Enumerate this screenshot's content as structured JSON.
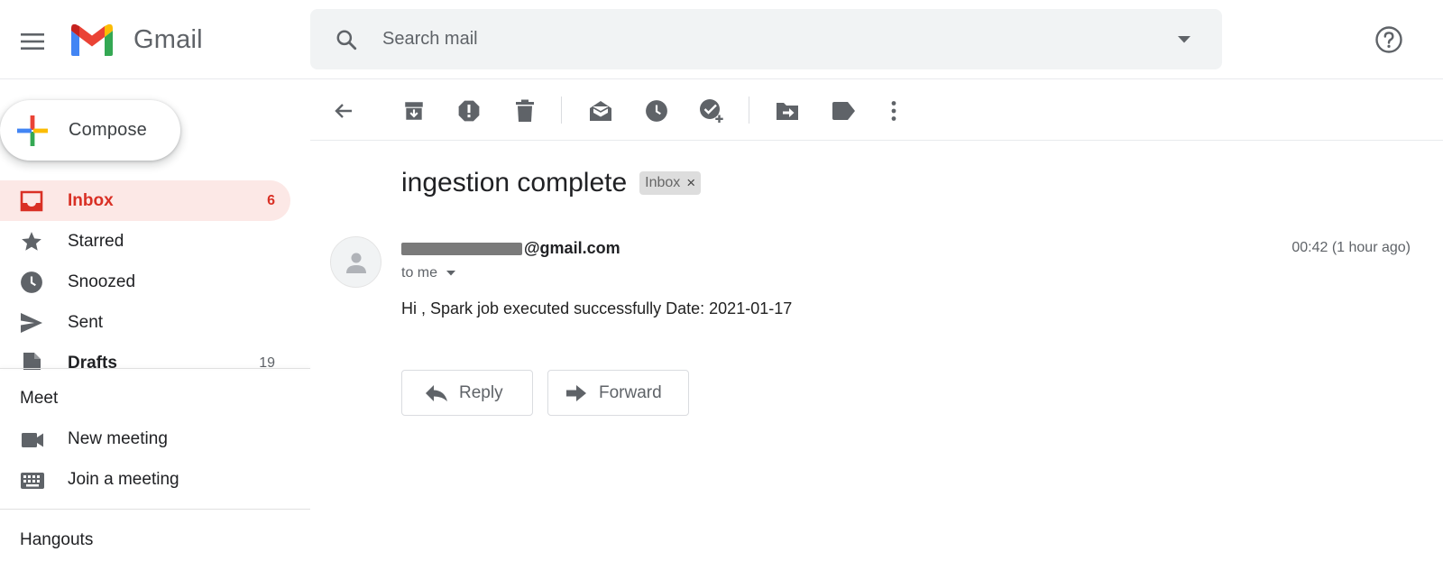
{
  "header": {
    "app_name": "Gmail",
    "search_placeholder": "Search mail"
  },
  "sidebar": {
    "compose_label": "Compose",
    "items": [
      {
        "label": "Inbox",
        "count": "6",
        "icon": "inbox-icon",
        "active": true
      },
      {
        "label": "Starred",
        "count": "",
        "icon": "star-icon"
      },
      {
        "label": "Snoozed",
        "count": "",
        "icon": "clock-icon"
      },
      {
        "label": "Sent",
        "count": "",
        "icon": "send-icon"
      },
      {
        "label": "Drafts",
        "count": "19",
        "icon": "draft-icon"
      }
    ],
    "meet": {
      "title": "Meet",
      "items": [
        {
          "label": "New meeting",
          "icon": "video-camera-icon"
        },
        {
          "label": "Join a meeting",
          "icon": "keyboard-icon"
        }
      ]
    },
    "hangouts_title": "Hangouts"
  },
  "message": {
    "subject": "ingestion complete",
    "label": "Inbox",
    "sender_visible": "@gmail.com",
    "recipient": "to me",
    "time": "00:42 (1 hour ago)",
    "body": "Hi , Spark job executed successfully Date: 2021-01-17",
    "reply_label": "Reply",
    "forward_label": "Forward"
  },
  "colors": {
    "accent": "#d93025",
    "active_bg": "#fce8e6",
    "icon_gray": "#5f6368",
    "search_bg": "#f1f3f4"
  }
}
